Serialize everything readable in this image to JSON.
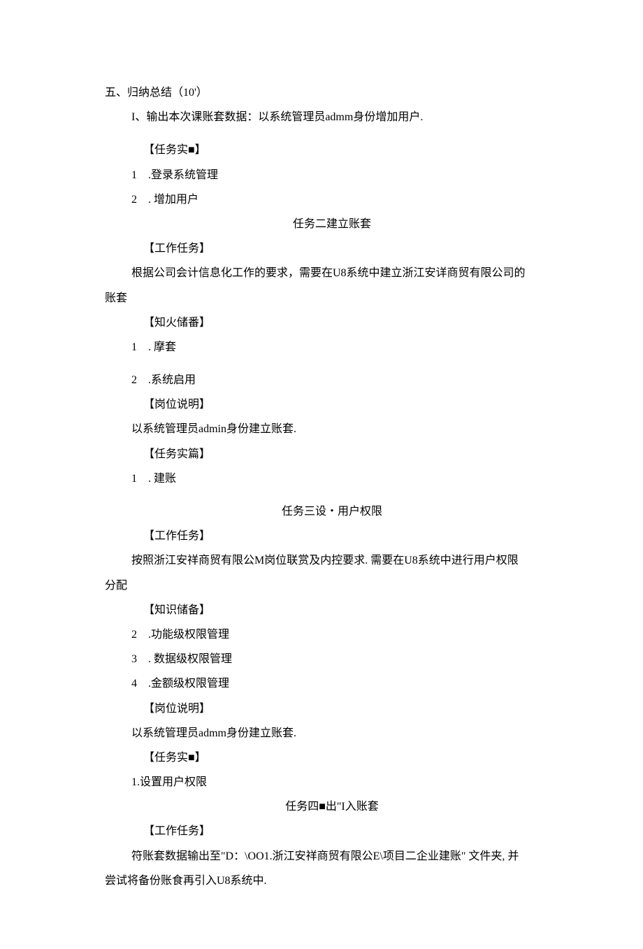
{
  "lines": {
    "l1": "五、归纳总结（10'）",
    "l2": "I、输出本次课账套数据：以系统管理员admm身份增加用户.",
    "l3": "【任务实■】",
    "l4": "1 .登录系统管理",
    "l5": "2 . 增加用户",
    "l6": "任务二建立账套",
    "l7": "【工作任务】",
    "l8": "根据公司会计信息化工作的要求，需要在U8系统中建立浙江安详商贸有限公司的",
    "l8b": "账套",
    "l9": "【知火储番】",
    "l10": "1 . 摩套",
    "l11": "2 .系统启用",
    "l12": "【岗位说明】",
    "l13": "以系统管理员admin身份建立账套.",
    "l14": "【任务实篇】",
    "l15": "1 . 建账",
    "l16": "任务三设・用户权限",
    "l17": "【工作任务】",
    "l18": "按照浙江安祥商贸有限公M岗位联赏及内控要求. 需要在U8系统中进行用户权限",
    "l18b": "分配",
    "l19": "【知识储备】",
    "l20": "2 .功能级权限管理",
    "l21": "3 . 数据级权限管理",
    "l22": "4 .金额级权限管理",
    "l23": "【岗位说明】",
    "l24": "以系统管理员admm身份建立账套.",
    "l25": "【任务实■】",
    "l26": "1.设置用户权限",
    "l27": "任务四■出\"I入账套",
    "l28": "【工作任务】",
    "l29": "符账套数据输出至\"D：\\OO1.浙江安祥商贸有限公E\\项目二企业建账\" 文件夹, 并",
    "l29b": "尝试将备份账食再引入U8系统中."
  }
}
